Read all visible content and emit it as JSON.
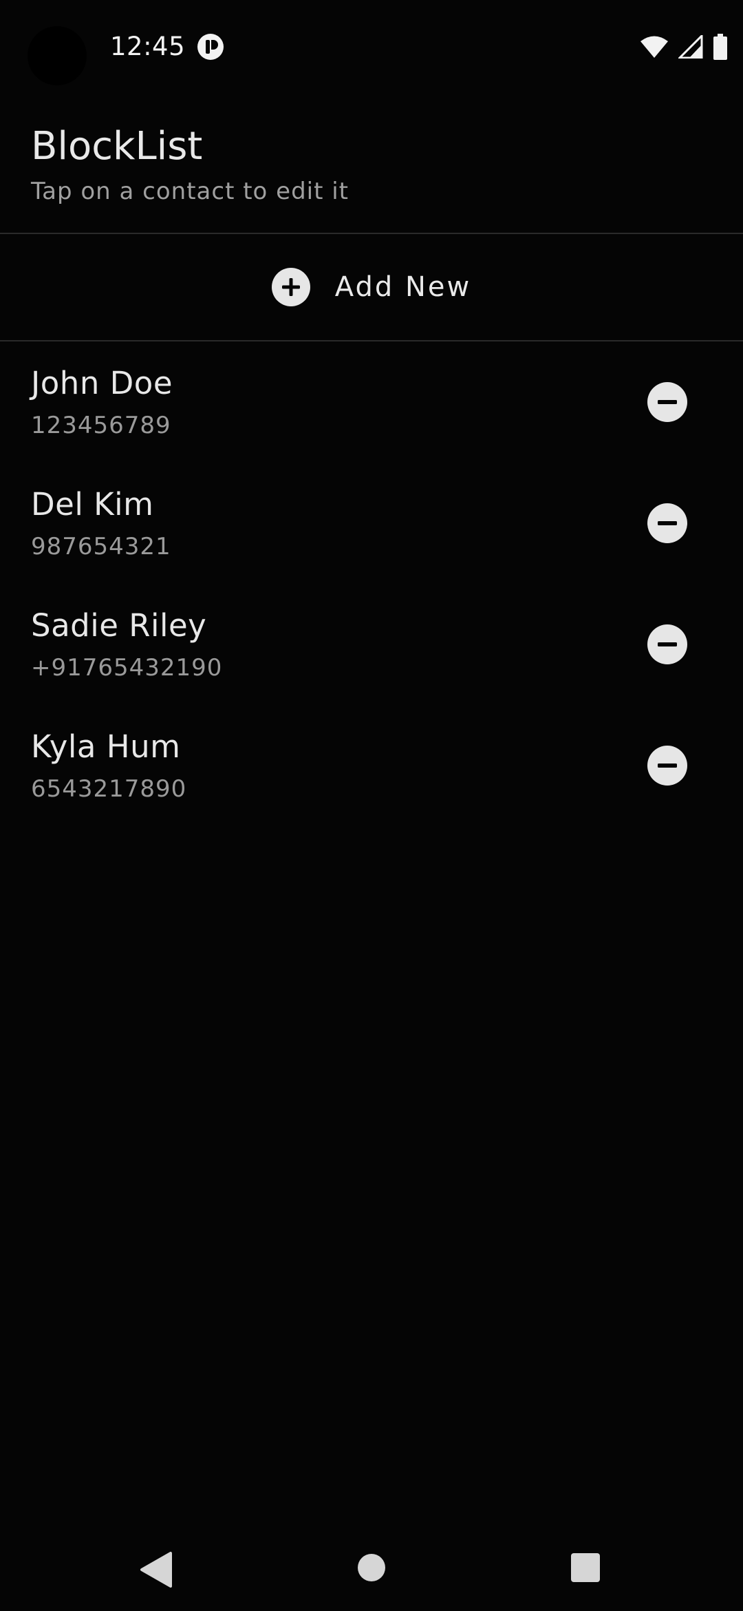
{
  "status_bar": {
    "time": "12:45",
    "app_icon": "notification-app-icon",
    "icons": [
      "wifi-icon",
      "signal-icon",
      "battery-icon"
    ]
  },
  "header": {
    "title": "BlockList",
    "subtitle": "Tap on a contact to edit it"
  },
  "add_new": {
    "label": "Add New",
    "icon": "plus-circle-icon"
  },
  "contacts": [
    {
      "name": "John Doe",
      "number": "123456789"
    },
    {
      "name": "Del Kim",
      "number": "987654321"
    },
    {
      "name": "Sadie Riley",
      "number": "+91765432190"
    },
    {
      "name": "Kyla Hum",
      "number": "6543217890"
    }
  ],
  "colors": {
    "background": "#050505",
    "primary_text": "#e8e8e8",
    "secondary_text": "#9a9a9a",
    "divider": "#2a2a2a",
    "icon_fill": "#e6e6e6"
  },
  "nav_bar": {
    "buttons": [
      "back-icon",
      "home-icon",
      "recents-icon"
    ]
  }
}
